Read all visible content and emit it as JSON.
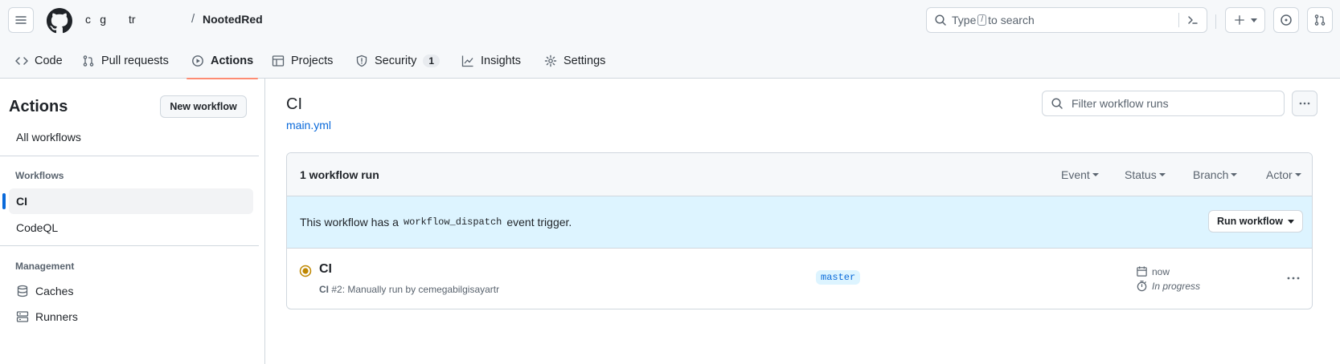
{
  "header": {
    "owner": "c    g          tr",
    "separator": "/",
    "repo": "NootedRed",
    "search_prefix": "Type",
    "search_key": "/",
    "search_suffix": "to search"
  },
  "tabs": [
    {
      "label": "Code",
      "icon": "code-icon"
    },
    {
      "label": "Pull requests",
      "icon": "git-pull-request-icon"
    },
    {
      "label": "Actions",
      "icon": "play-icon",
      "active": true
    },
    {
      "label": "Projects",
      "icon": "table-icon"
    },
    {
      "label": "Security",
      "icon": "shield-icon",
      "count": "1"
    },
    {
      "label": "Insights",
      "icon": "graph-icon"
    },
    {
      "label": "Settings",
      "icon": "gear-icon"
    }
  ],
  "sidebar": {
    "title": "Actions",
    "new_workflow": "New workflow",
    "all_workflows": "All workflows",
    "workflows_heading": "Workflows",
    "workflows": [
      "CI",
      "CodeQL"
    ],
    "management_heading": "Management",
    "management": [
      {
        "label": "Caches",
        "icon": "database-icon"
      },
      {
        "label": "Runners",
        "icon": "server-icon"
      }
    ]
  },
  "main": {
    "title": "CI",
    "file_link": "main.yml",
    "filter_placeholder": "Filter workflow runs",
    "run_count": "1 workflow run",
    "facets": [
      "Event",
      "Status",
      "Branch",
      "Actor"
    ],
    "banner_prefix": "This workflow has a",
    "banner_code": "workflow_dispatch",
    "banner_suffix": "event trigger.",
    "run_workflow": "Run workflow",
    "run": {
      "title": "CI",
      "sub_bold": "CI",
      "sub_rest": "#2: Manually run by cemegabilgisayartr",
      "branch": "master",
      "time": "now",
      "duration": "In progress"
    }
  },
  "colors": {
    "accent": "#0969da",
    "tab_underline": "#fd8c73",
    "in_progress": "#bf8700",
    "banner_bg": "#ddf4ff"
  }
}
